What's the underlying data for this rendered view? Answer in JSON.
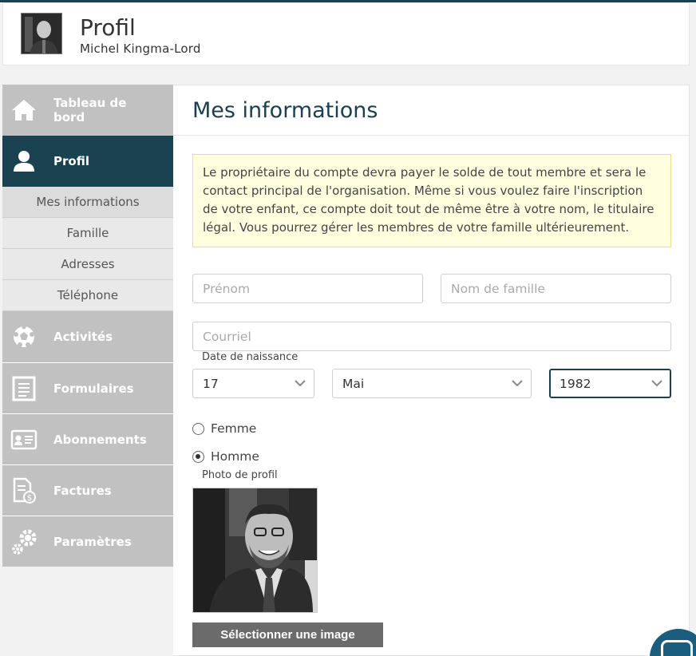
{
  "header": {
    "title": "Profil",
    "user_name": "Michel Kingma-Lord"
  },
  "sidebar": {
    "items": [
      {
        "label": "Tableau de bord",
        "icon": "home-icon"
      },
      {
        "label": "Profil",
        "icon": "user-icon",
        "active": true
      },
      {
        "label": "Activités",
        "icon": "soccer-ball-icon"
      },
      {
        "label": "Formulaires",
        "icon": "form-icon"
      },
      {
        "label": "Abonnements",
        "icon": "id-card-icon"
      },
      {
        "label": "Factures",
        "icon": "invoice-icon"
      },
      {
        "label": "Paramètres",
        "icon": "gears-icon"
      }
    ],
    "profile_subitems": [
      "Mes informations",
      "Famille",
      "Adresses",
      "Téléphone"
    ]
  },
  "main": {
    "title": "Mes informations",
    "notice": "Le propriétaire du compte devra payer le solde de tout membre et sera le contact principal de l'organisation. Même si vous voulez faire l'inscription de votre enfant, ce compte doit tout de même être à votre nom, le titulaire légal. Vous pourrez gérer les membres de votre famille ultérieurement.",
    "first_name_placeholder": "Prénom",
    "last_name_placeholder": "Nom de famille",
    "email_placeholder": "Courriel",
    "birthdate_label": "Date de naissance",
    "birth_day": "17",
    "birth_month": "Mai",
    "birth_year": "1982",
    "gender_female": "Femme",
    "gender_male": "Homme",
    "gender_selected": "Homme",
    "photo_label": "Photo de profil",
    "select_image_button": "Sélectionner une image"
  },
  "colors": {
    "brand_dark": "#1b4251",
    "sidebar_gray": "#c1c1c1",
    "notice_bg": "#ffffe0",
    "button_gray": "#6b6b6b"
  }
}
